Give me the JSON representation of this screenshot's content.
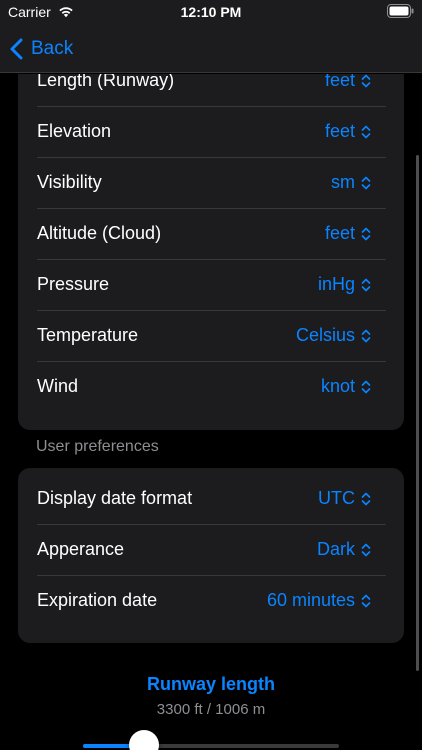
{
  "status_bar": {
    "carrier": "Carrier",
    "time": "12:10 PM",
    "icons": [
      "wifi-icon",
      "battery-icon"
    ]
  },
  "nav": {
    "back_label": "Back"
  },
  "units_rows": [
    {
      "label": "Length (Runway)",
      "value": "feet"
    },
    {
      "label": "Elevation",
      "value": "feet"
    },
    {
      "label": "Visibility",
      "value": "sm"
    },
    {
      "label": "Altitude (Cloud)",
      "value": "feet"
    },
    {
      "label": "Pressure",
      "value": "inHg"
    },
    {
      "label": "Temperature",
      "value": "Celsius"
    },
    {
      "label": "Wind",
      "value": "knot"
    }
  ],
  "user_preferences": {
    "header": "User preferences",
    "rows": [
      {
        "label": "Display date format",
        "value": "UTC"
      },
      {
        "label": "Apperance",
        "value": "Dark"
      },
      {
        "label": "Expiration date",
        "value": "60 minutes"
      }
    ]
  },
  "slider": {
    "title": "Runway length",
    "subtitle": "3300 ft / 1006 m",
    "fraction": 0.24
  },
  "colors": {
    "accent": "#0a84ff",
    "background": "#000000",
    "group_background": "#1c1c1e",
    "separator": "#38383a",
    "secondary_text": "#8e8e93"
  }
}
